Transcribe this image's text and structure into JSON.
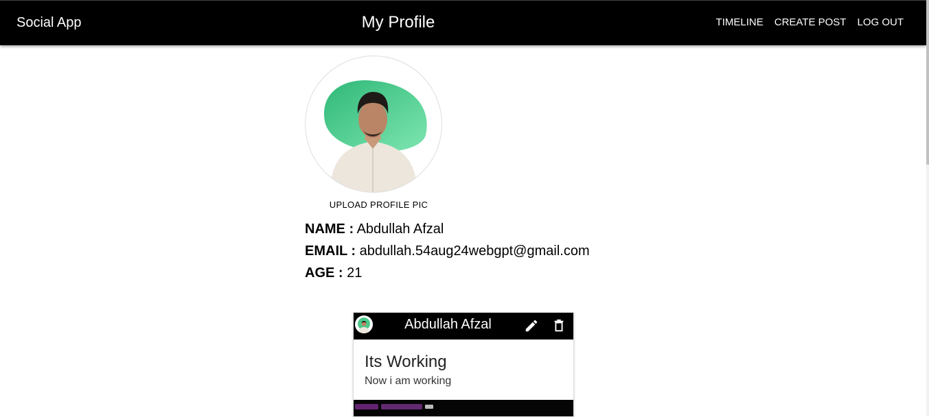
{
  "header": {
    "brand": "Social App",
    "title": "My Profile",
    "nav": [
      "TIMELINE",
      "CREATE POST",
      "LOG OUT"
    ]
  },
  "profile": {
    "upload_label": "UPLOAD PROFILE PIC",
    "name_label": "NAME :",
    "name": "Abdullah Afzal",
    "email_label": "EMAIL :",
    "email": "abdullah.54aug24webgpt@gmail.com",
    "age_label": "AGE :",
    "age": "21"
  },
  "post": {
    "author": "Abdullah Afzal",
    "title": "Its Working",
    "body": "Now i am working",
    "icons": [
      "edit-icon",
      "delete-icon"
    ]
  },
  "colors": {
    "appbar": "#000000",
    "avatar_green": "#3fbf7f"
  }
}
